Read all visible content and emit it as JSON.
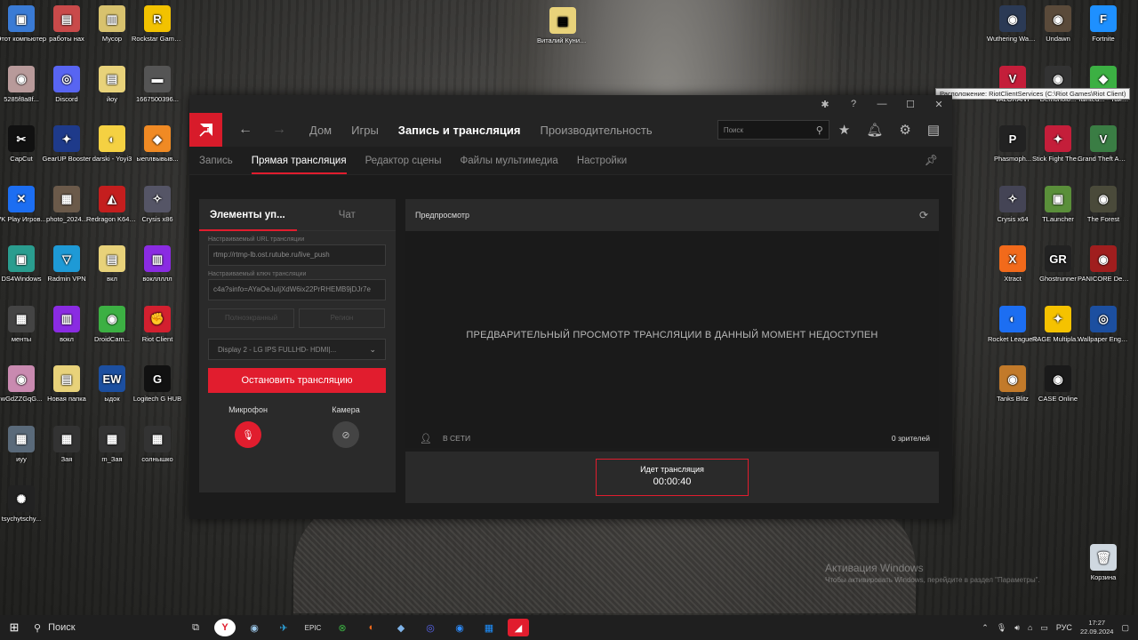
{
  "desktop": {
    "left_icons": [
      {
        "label": "Этот компьютер",
        "color": "#3a7bd5",
        "glyph": "▣"
      },
      {
        "label": "работы нах",
        "color": "#c94a4a",
        "glyph": "▤"
      },
      {
        "label": "Мусор",
        "color": "#d8c26e",
        "glyph": "▥"
      },
      {
        "label": "Rockstar Games ...",
        "color": "#f2c200",
        "glyph": "R"
      },
      {
        "label": "5285f8a8f...",
        "color": "#b89a9a",
        "glyph": "◉"
      },
      {
        "label": "Discord",
        "color": "#5865f2",
        "glyph": "◎"
      },
      {
        "label": "йоу",
        "color": "#e8d27a",
        "glyph": "▤"
      },
      {
        "label": "1667500396...",
        "color": "#555",
        "glyph": "▬"
      },
      {
        "label": "CapCut",
        "color": "#111",
        "glyph": "✂"
      },
      {
        "label": "GearUP Booster",
        "color": "#1e3a8a",
        "glyph": "✦"
      },
      {
        "label": "darski - Yoyi3",
        "color": "#f5d142",
        "glyph": "◐"
      },
      {
        "label": "ыеплвывыв...",
        "color": "#f08a24",
        "glyph": "◆"
      },
      {
        "label": "VK Play Игров...",
        "color": "#1c6ef2",
        "glyph": "✕"
      },
      {
        "label": "photo_2024...",
        "color": "#6b5a4a",
        "glyph": "▦"
      },
      {
        "label": "Redragon K644CGO-...",
        "color": "#c41e1e",
        "glyph": "◭"
      },
      {
        "label": "Crysis x86",
        "color": "#556",
        "glyph": "✧"
      },
      {
        "label": "DS4Windows",
        "color": "#2a9d8f",
        "glyph": "▣"
      },
      {
        "label": "Radmin VPN",
        "color": "#1e9ad6",
        "glyph": "▽"
      },
      {
        "label": "вкл",
        "color": "#e8d27a",
        "glyph": "▤"
      },
      {
        "label": "вокллллл",
        "color": "#8a2be2",
        "glyph": "▥"
      },
      {
        "label": "менты",
        "color": "#444",
        "glyph": "▦"
      },
      {
        "label": "вокл",
        "color": "#8a2be2",
        "glyph": "▥"
      },
      {
        "label": "DroidCam...",
        "color": "#3cb043",
        "glyph": "◉"
      },
      {
        "label": "Riot Client",
        "color": "#d3202f",
        "glyph": "✊"
      },
      {
        "label": "wGdZZGqG...",
        "color": "#c98ab0",
        "glyph": "◉"
      },
      {
        "label": "Новая папка",
        "color": "#e8d27a",
        "glyph": "▤"
      },
      {
        "label": "ыдок",
        "color": "#1c4fa0",
        "glyph": "EW"
      },
      {
        "label": "Logitech G HUB",
        "color": "#111",
        "glyph": "G"
      },
      {
        "label": "иуу",
        "color": "#5a6a7a",
        "glyph": "▦"
      },
      {
        "label": "Зая",
        "color": "#333",
        "glyph": "▦"
      },
      {
        "label": "m_Зая",
        "color": "#333",
        "glyph": "▦"
      },
      {
        "label": "солнышко",
        "color": "#333",
        "glyph": "▦"
      },
      {
        "label": "tsychytschy...",
        "color": "#222",
        "glyph": "✺"
      }
    ],
    "center_icon": {
      "label": "Виталий Куницын",
      "color": "#e8d27a",
      "glyph": "▤"
    },
    "right_icons": [
      {
        "label": "Wuthering Waves",
        "color": "#2b3a55",
        "glyph": "◉"
      },
      {
        "label": "Undawn",
        "color": "#5a4a3a",
        "glyph": "◉"
      },
      {
        "label": "Fortnite",
        "color": "#1e90ff",
        "glyph": "F"
      },
      {
        "label": "VALORANT",
        "color": "#c41e3a",
        "glyph": "V"
      },
      {
        "label": "Demonolo...",
        "color": "#333",
        "glyph": "◉"
      },
      {
        "label": "Tainted... - Таинств...",
        "color": "#3cb043",
        "glyph": "◆"
      },
      {
        "label": "Phasmoph...",
        "color": "#222",
        "glyph": "P"
      },
      {
        "label": "Stick Fight The Game",
        "color": "#c41e3a",
        "glyph": "✦"
      },
      {
        "label": "Grand Theft Auto V",
        "color": "#3a7d44",
        "glyph": "V"
      },
      {
        "label": "Crysis x64",
        "color": "#445",
        "glyph": "✧"
      },
      {
        "label": "TLauncher",
        "color": "#5a8f3a",
        "glyph": "▣"
      },
      {
        "label": "The Forest",
        "color": "#4a4a3a",
        "glyph": "◉"
      },
      {
        "label": "Xtract",
        "color": "#f26a1b",
        "glyph": "X"
      },
      {
        "label": "Ghostrunner",
        "color": "#222",
        "glyph": "GR"
      },
      {
        "label": "PANICORE Demo",
        "color": "#a01e1e",
        "glyph": "◉"
      },
      {
        "label": "Rocket League®",
        "color": "#1c6ef2",
        "glyph": "◐"
      },
      {
        "label": "RAGE Multiplayer",
        "color": "#f5c200",
        "glyph": "✦"
      },
      {
        "label": "Wallpaper Engine",
        "color": "#1c4fa0",
        "glyph": "◎"
      },
      {
        "label": "Tanks Blitz",
        "color": "#c27a2a",
        "glyph": "◉"
      },
      {
        "label": "CASE Online",
        "color": "#1a1a1a",
        "glyph": "◉"
      },
      {
        "label": "Корзина",
        "color": "#cfd8e0",
        "glyph": "🗑"
      }
    ],
    "tooltip": "Расположение: RiotClientServices (C:\\Riot Games\\Riot Client)",
    "activation_title": "Активация Windows",
    "activation_text": "Чтобы активировать Windows, перейдите в раздел \"Параметры\"."
  },
  "app": {
    "nav": {
      "back": "←",
      "forward": "→",
      "items": [
        "Дом",
        "Игры",
        "Запись и трансляция",
        "Производительность"
      ],
      "search_placeholder": "Поиск"
    },
    "subnav": [
      "Запись",
      "Прямая трансляция",
      "Редактор сцены",
      "Файлы мультимедиа",
      "Настройки"
    ],
    "left_panel": {
      "tab_controls": "Элементы уп...",
      "tab_chat": "Чат",
      "url_label": "Настраиваемый URL трансляции",
      "url_value": "rtmp://rtmp-lb.ost.rutube.ru/live_push",
      "key_label": "Настраиваемый ключ трансляции",
      "key_value": "c4a?sinfo=AYaOeJuIjXdW6ix22PrRHEMB9jDJr7e",
      "btn_a": "Полноэкранный",
      "btn_b": "Регион",
      "display": "Display 2 - LG IPS FULLHD- HDMI|...",
      "stop_btn": "Остановить трансляцию",
      "mic_label": "Микрофон",
      "cam_label": "Камера"
    },
    "preview": {
      "title": "Предпросмотр",
      "unavailable": "ПРЕДВАРИТЕЛЬНЫЙ ПРОСМОТР ТРАНСЛЯЦИИ В ДАННЫЙ МОМЕНТ НЕДОСТУПЕН",
      "online": "В СЕТИ",
      "viewers": "0 зрителей",
      "live_label": "Идет трансляция",
      "live_time": "00:00:40"
    },
    "accent": "#e11d2e"
  },
  "taskbar": {
    "search": "Поиск",
    "lang": "РУС",
    "time": "17:27",
    "date": "22.09.2024"
  }
}
